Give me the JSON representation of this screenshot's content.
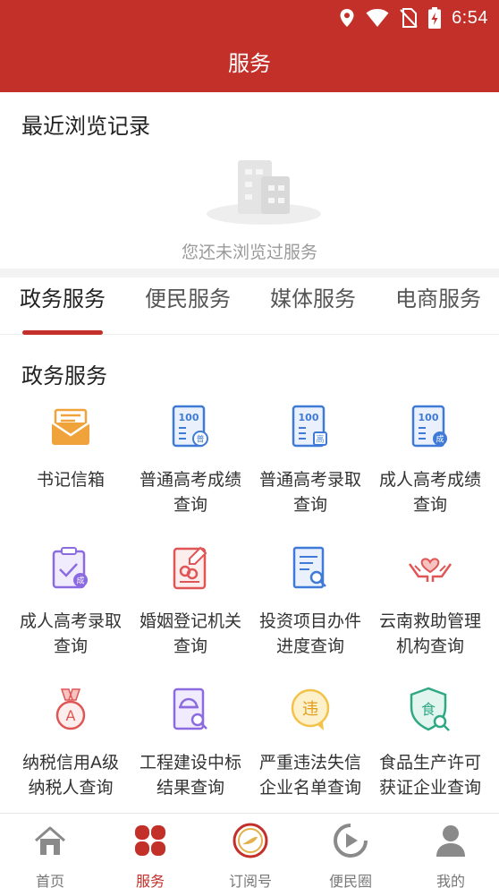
{
  "status_bar": {
    "time": "6:54",
    "icons": [
      "location-icon",
      "wifi-icon",
      "no-sim-icon",
      "battery-charging-icon"
    ]
  },
  "header": {
    "title": "服务"
  },
  "recent": {
    "title": "最近浏览记录",
    "empty_text": "您还未浏览过服务"
  },
  "tabs": [
    {
      "label": "政务服务",
      "active": true
    },
    {
      "label": "便民服务",
      "active": false
    },
    {
      "label": "媒体服务",
      "active": false
    },
    {
      "label": "电商服务",
      "active": false
    }
  ],
  "section": {
    "title": "政务服务"
  },
  "services": [
    {
      "label": "书记信箱",
      "icon": "mailbox-icon"
    },
    {
      "label": "普通高考成绩查询",
      "icon": "score-report-icon"
    },
    {
      "label": "普通高考录取查询",
      "icon": "admission-report-icon"
    },
    {
      "label": "成人高考成绩查询",
      "icon": "adult-score-report-icon"
    },
    {
      "label": "成人高考录取查询",
      "icon": "adult-admission-check-icon"
    },
    {
      "label": "婚姻登记机关查询",
      "icon": "marriage-registry-icon"
    },
    {
      "label": "投资项目办件进度查询",
      "icon": "investment-search-icon"
    },
    {
      "label": "云南救助管理机构查询",
      "icon": "rescue-hands-icon"
    },
    {
      "label": "纳税信用A级纳税人查询",
      "icon": "tax-medal-icon"
    },
    {
      "label": "工程建设中标结果查询",
      "icon": "construction-search-icon"
    },
    {
      "label": "严重违法失信企业名单查询",
      "icon": "violation-icon"
    },
    {
      "label": "食品生产许可获证企业查询",
      "icon": "food-license-icon"
    }
  ],
  "tabbar": [
    {
      "label": "首页",
      "icon": "home-icon",
      "active": false
    },
    {
      "label": "服务",
      "icon": "services-clover-icon",
      "active": true
    },
    {
      "label": "订阅号",
      "icon": "subscription-icon",
      "active": false
    },
    {
      "label": "便民圈",
      "icon": "play-circle-icon",
      "active": false
    },
    {
      "label": "我的",
      "icon": "profile-icon",
      "active": false
    }
  ],
  "colors": {
    "brand": "#c3302a",
    "icon_blue": "#3f7bd6",
    "icon_purple": "#8c6be0",
    "icon_orange": "#f0a33a"
  }
}
